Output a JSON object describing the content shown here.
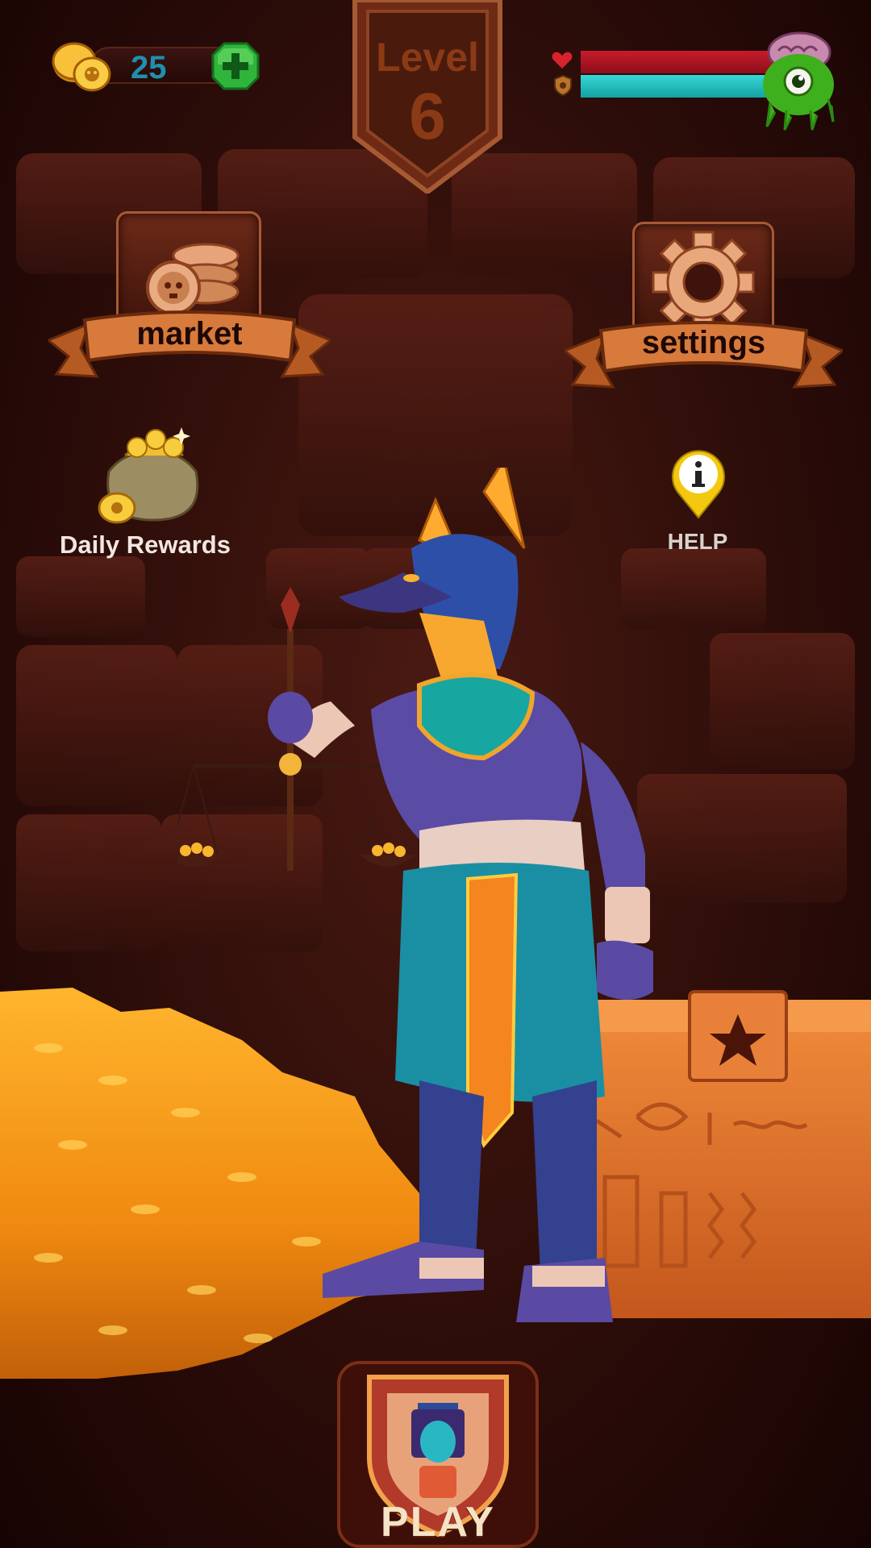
{
  "hud": {
    "coins": "25",
    "level_label": "Level",
    "level_number": "6",
    "health_fraction": 1.0,
    "shield_fraction": 1.0
  },
  "menu": {
    "market_label": "market",
    "settings_label": "settings",
    "daily_rewards_label": "Daily Rewards",
    "help_label": "HELP",
    "play_label": "PLAY"
  },
  "icons": {
    "coins": "coin-stack-icon",
    "add": "plus-gem-icon",
    "health": "heart-icon",
    "shield": "shield-icon",
    "avatar": "green-monster-avatar",
    "market": "skull-coins-icon",
    "settings": "gear-icon",
    "daily": "treasure-sack-icon",
    "help": "info-pin-icon",
    "play": "pharaoh-shield-icon"
  },
  "colors": {
    "background": "#2d0d09",
    "accent": "#a85a34",
    "gold": "#f5a623",
    "health": "#c71c2c",
    "shield": "#37d7d4",
    "coin_text": "#1f8fb0"
  }
}
